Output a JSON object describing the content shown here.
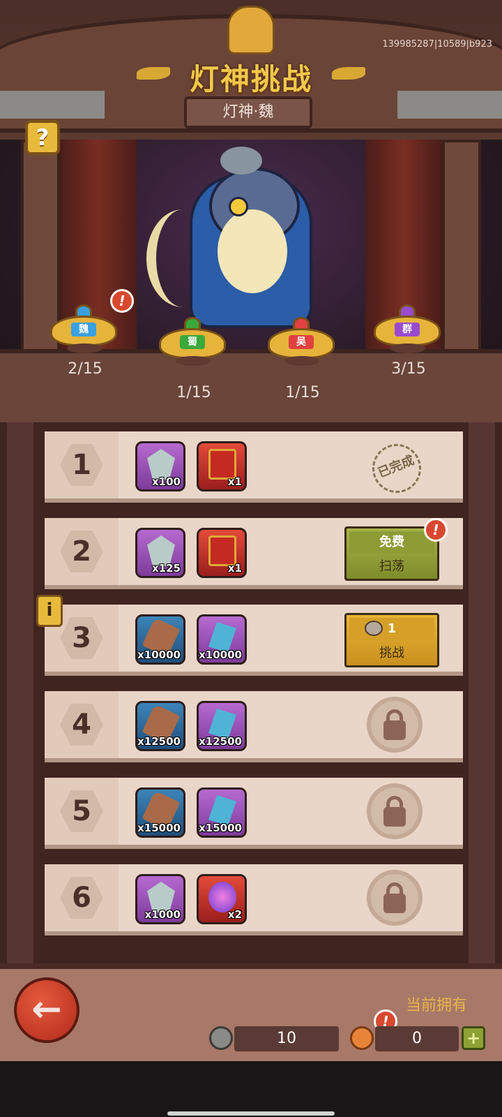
{
  "header": {
    "title": "灯神挑战",
    "subtitle": "灯神·魏",
    "debug_id": "139985287|10589|b923",
    "help_label": "?"
  },
  "lamps": [
    {
      "badge": "魏",
      "count": "2/15",
      "color": "#3aa0e0",
      "alert": true
    },
    {
      "badge": "蜀",
      "count": "1/15",
      "color": "#3aa83a",
      "alert": false
    },
    {
      "badge": "吴",
      "count": "1/15",
      "color": "#e04040",
      "alert": false
    },
    {
      "badge": "群",
      "count": "3/15",
      "color": "#9a4ad0",
      "alert": false
    }
  ],
  "alert_glyph": "!",
  "stages": [
    {
      "num": "1",
      "items": [
        {
          "type": "crystal",
          "bg": "purple",
          "qty": "x100"
        },
        {
          "type": "chest",
          "bg": "red",
          "qty": "x1"
        }
      ],
      "status": "completed",
      "stamp": "已完成"
    },
    {
      "num": "2",
      "items": [
        {
          "type": "crystal",
          "bg": "purple",
          "qty": "x125"
        },
        {
          "type": "chest",
          "bg": "red",
          "qty": "x1"
        }
      ],
      "status": "sweep",
      "btn_top": "免费",
      "btn_bottom": "扫荡"
    },
    {
      "num": "3",
      "items": [
        {
          "type": "ore",
          "bg": "blue",
          "qty": "x10000"
        },
        {
          "type": "rune",
          "bg": "purple",
          "qty": "x10000"
        }
      ],
      "status": "challenge",
      "btn_top": "1",
      "btn_bottom": "挑战"
    },
    {
      "num": "4",
      "items": [
        {
          "type": "ore",
          "bg": "blue",
          "qty": "x12500"
        },
        {
          "type": "rune",
          "bg": "purple",
          "qty": "x12500"
        }
      ],
      "status": "locked"
    },
    {
      "num": "5",
      "items": [
        {
          "type": "ore",
          "bg": "blue",
          "qty": "x15000"
        },
        {
          "type": "rune",
          "bg": "purple",
          "qty": "x15000"
        }
      ],
      "status": "locked"
    },
    {
      "num": "6",
      "items": [
        {
          "type": "crystal",
          "bg": "purple",
          "qty": "x1000"
        },
        {
          "type": "orb",
          "bg": "red",
          "qty": "x2"
        }
      ],
      "status": "locked"
    }
  ],
  "info_label": "i",
  "footer": {
    "owned_label": "当前拥有",
    "lamp_count": "10",
    "token_count": "0",
    "plus_label": "+",
    "back_glyph": "←"
  },
  "colors": {
    "accent": "#f1c84a",
    "sweep_green": "#a9b44a",
    "challenge_gold": "#e9b636"
  }
}
